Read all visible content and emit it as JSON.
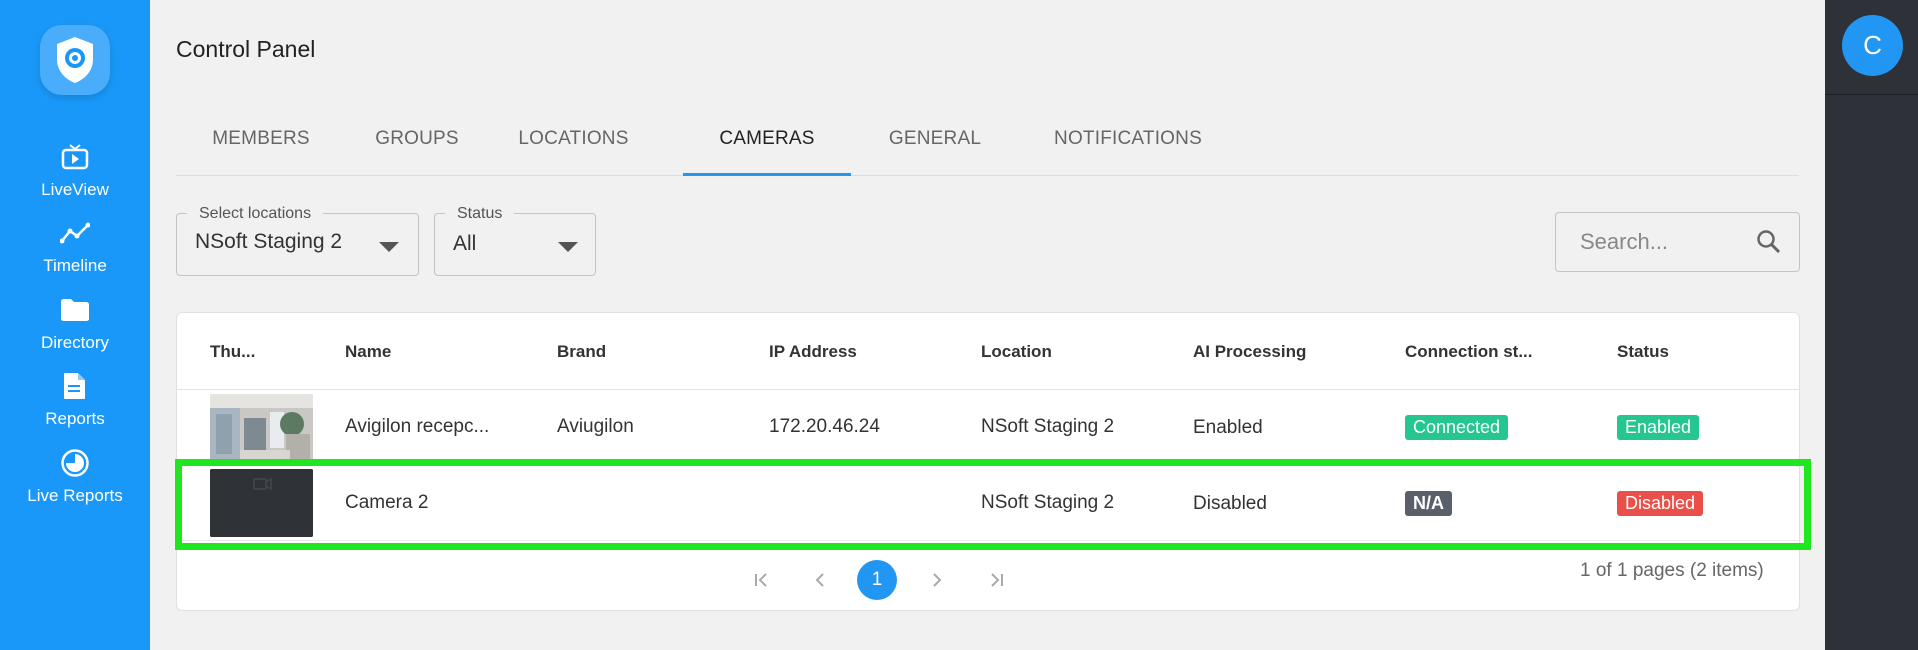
{
  "sidebar": {
    "items": [
      {
        "label": "LiveView",
        "icon": "tv-play-icon"
      },
      {
        "label": "Timeline",
        "icon": "timeline-icon"
      },
      {
        "label": "Directory",
        "icon": "folder-icon"
      },
      {
        "label": "Reports",
        "icon": "document-icon"
      },
      {
        "label": "Live Reports",
        "icon": "pie-chart-icon"
      }
    ]
  },
  "header": {
    "title": "Control Panel"
  },
  "user": {
    "avatar_letter": "C"
  },
  "tabs": [
    {
      "label": "MEMBERS",
      "active": false
    },
    {
      "label": "GROUPS",
      "active": false
    },
    {
      "label": "LOCATIONS",
      "active": false
    },
    {
      "label": "CAMERAS",
      "active": true
    },
    {
      "label": "GENERAL",
      "active": false
    },
    {
      "label": "NOTIFICATIONS",
      "active": false
    }
  ],
  "filters": {
    "location": {
      "label": "Select locations",
      "value": "NSoft Staging 2"
    },
    "status": {
      "label": "Status",
      "value": "All"
    }
  },
  "search": {
    "placeholder": "Search..."
  },
  "table": {
    "columns": [
      "Thu...",
      "Name",
      "Brand",
      "IP Address",
      "Location",
      "AI Processing",
      "Connection st...",
      "Status"
    ],
    "rows": [
      {
        "name": "Avigilon recepc...",
        "brand": "Aviugilon",
        "ip": "172.20.46.24",
        "location": "NSoft Staging 2",
        "ai": "Enabled",
        "connection": "Connected",
        "status": "Enabled"
      },
      {
        "name": "Camera 2",
        "brand": "",
        "ip": "",
        "location": "NSoft Staging 2",
        "ai": "Disabled",
        "connection": "N/A",
        "status": "Disabled"
      }
    ]
  },
  "pagination": {
    "current": "1",
    "info": "1 of 1 pages (2 items)"
  },
  "colors": {
    "sidebar": "#1a98f9",
    "accent": "#2196f3",
    "connected": "#25c68f",
    "na": "#5a5f69",
    "disabled": "#ea4f4a",
    "highlight": "#1fe61f"
  }
}
